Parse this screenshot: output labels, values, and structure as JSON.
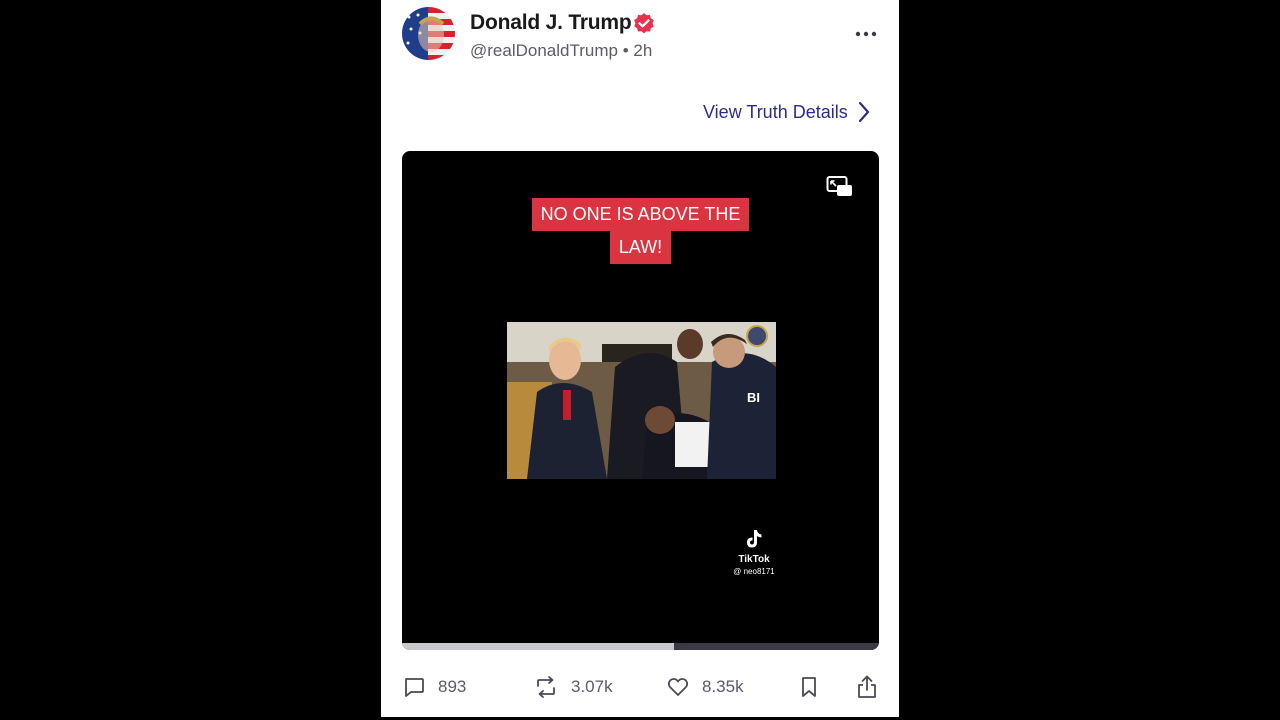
{
  "post": {
    "author_name": "Donald J. Trump",
    "author_handle": "@realDonaldTrump",
    "separator": "•",
    "time_ago": "2h",
    "view_details_label": "View Truth Details",
    "video": {
      "caption_line1": "NO ONE IS ABOVE THE",
      "caption_line2": "LAW!",
      "watermark_label": "TikTok",
      "watermark_handle": "@ neo8171",
      "progress": 0.57
    },
    "stats": {
      "replies": "893",
      "retruths": "3.07k",
      "likes": "8.35k"
    }
  },
  "colors": {
    "verified": "#e6324f",
    "link": "#2c2c8c",
    "caption_bg": "#d9343f"
  },
  "icons": [
    "verified-badge-icon",
    "more-options-icon",
    "chevron-right-icon",
    "picture-in-picture-icon",
    "tiktok-icon",
    "reply-icon",
    "retruth-icon",
    "like-icon",
    "bookmark-icon",
    "share-icon"
  ]
}
